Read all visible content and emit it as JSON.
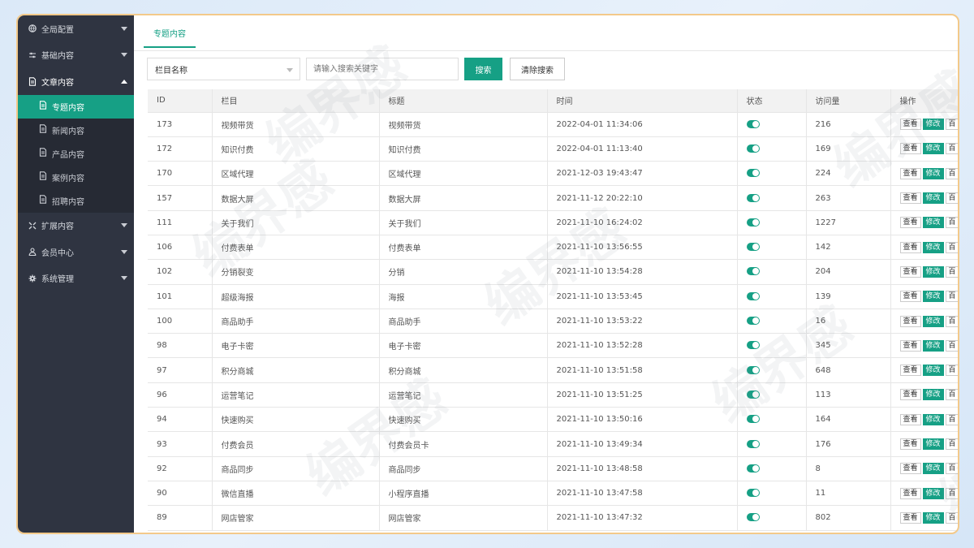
{
  "sidebar": {
    "items": [
      {
        "label": "全局配置",
        "icon": "globe-icon",
        "expanded": false
      },
      {
        "label": "基础内容",
        "icon": "sliders-icon",
        "expanded": false
      },
      {
        "label": "文章内容",
        "icon": "document-icon",
        "expanded": true
      },
      {
        "label": "扩展内容",
        "icon": "expand-icon",
        "expanded": false
      },
      {
        "label": "会员中心",
        "icon": "user-icon",
        "expanded": false
      },
      {
        "label": "系统管理",
        "icon": "gear-icon",
        "expanded": false
      }
    ],
    "sub_items": [
      {
        "label": "专题内容",
        "active": true
      },
      {
        "label": "新闻内容",
        "active": false
      },
      {
        "label": "产品内容",
        "active": false
      },
      {
        "label": "案例内容",
        "active": false
      },
      {
        "label": "招聘内容",
        "active": false
      }
    ]
  },
  "tabs": [
    {
      "label": "专题内容"
    }
  ],
  "toolbar": {
    "select_value": "栏目名称",
    "search_placeholder": "请输入搜索关键字",
    "search_button": "搜索",
    "clear_button": "清除搜索"
  },
  "table": {
    "headers": [
      "ID",
      "栏目",
      "标题",
      "时间",
      "状态",
      "访问量",
      "操作"
    ],
    "actions": [
      "查看",
      "修改",
      "百"
    ],
    "rows": [
      {
        "id": "173",
        "column": "视频带货",
        "title": "视频带货",
        "time": "2022-04-01 11:34:06",
        "status": true,
        "visits": "216"
      },
      {
        "id": "172",
        "column": "知识付费",
        "title": "知识付费",
        "time": "2022-04-01 11:13:40",
        "status": true,
        "visits": "169"
      },
      {
        "id": "170",
        "column": "区域代理",
        "title": "区域代理",
        "time": "2021-12-03 19:43:47",
        "status": true,
        "visits": "224"
      },
      {
        "id": "157",
        "column": "数据大屏",
        "title": "数据大屏",
        "time": "2021-11-12 20:22:10",
        "status": true,
        "visits": "263"
      },
      {
        "id": "111",
        "column": "关于我们",
        "title": "关于我们",
        "time": "2021-11-10 16:24:02",
        "status": true,
        "visits": "1227"
      },
      {
        "id": "106",
        "column": "付费表单",
        "title": "付费表单",
        "time": "2021-11-10 13:56:55",
        "status": true,
        "visits": "142"
      },
      {
        "id": "102",
        "column": "分销裂变",
        "title": "分销",
        "time": "2021-11-10 13:54:28",
        "status": true,
        "visits": "204"
      },
      {
        "id": "101",
        "column": "超级海报",
        "title": "海报",
        "time": "2021-11-10 13:53:45",
        "status": true,
        "visits": "139"
      },
      {
        "id": "100",
        "column": "商品助手",
        "title": "商品助手",
        "time": "2021-11-10 13:53:22",
        "status": true,
        "visits": "16"
      },
      {
        "id": "98",
        "column": "电子卡密",
        "title": "电子卡密",
        "time": "2021-11-10 13:52:28",
        "status": true,
        "visits": "345"
      },
      {
        "id": "97",
        "column": "积分商城",
        "title": "积分商城",
        "time": "2021-11-10 13:51:58",
        "status": true,
        "visits": "648"
      },
      {
        "id": "96",
        "column": "运营笔记",
        "title": "运营笔记",
        "time": "2021-11-10 13:51:25",
        "status": true,
        "visits": "113"
      },
      {
        "id": "94",
        "column": "快速购买",
        "title": "快速购买",
        "time": "2021-11-10 13:50:16",
        "status": true,
        "visits": "164"
      },
      {
        "id": "93",
        "column": "付费会员",
        "title": "付费会员卡",
        "time": "2021-11-10 13:49:34",
        "status": true,
        "visits": "176"
      },
      {
        "id": "92",
        "column": "商品同步",
        "title": "商品同步",
        "time": "2021-11-10 13:48:58",
        "status": true,
        "visits": "8"
      },
      {
        "id": "90",
        "column": "微信直播",
        "title": "小程序直播",
        "time": "2021-11-10 13:47:58",
        "status": true,
        "visits": "11"
      },
      {
        "id": "89",
        "column": "网店管家",
        "title": "网店管家",
        "time": "2021-11-10 13:47:32",
        "status": true,
        "visits": "802"
      }
    ]
  },
  "watermark": "编界感",
  "colors": {
    "accent": "#16a085",
    "sidebar_bg": "#2f3441",
    "frame_border": "#f3c98a"
  }
}
